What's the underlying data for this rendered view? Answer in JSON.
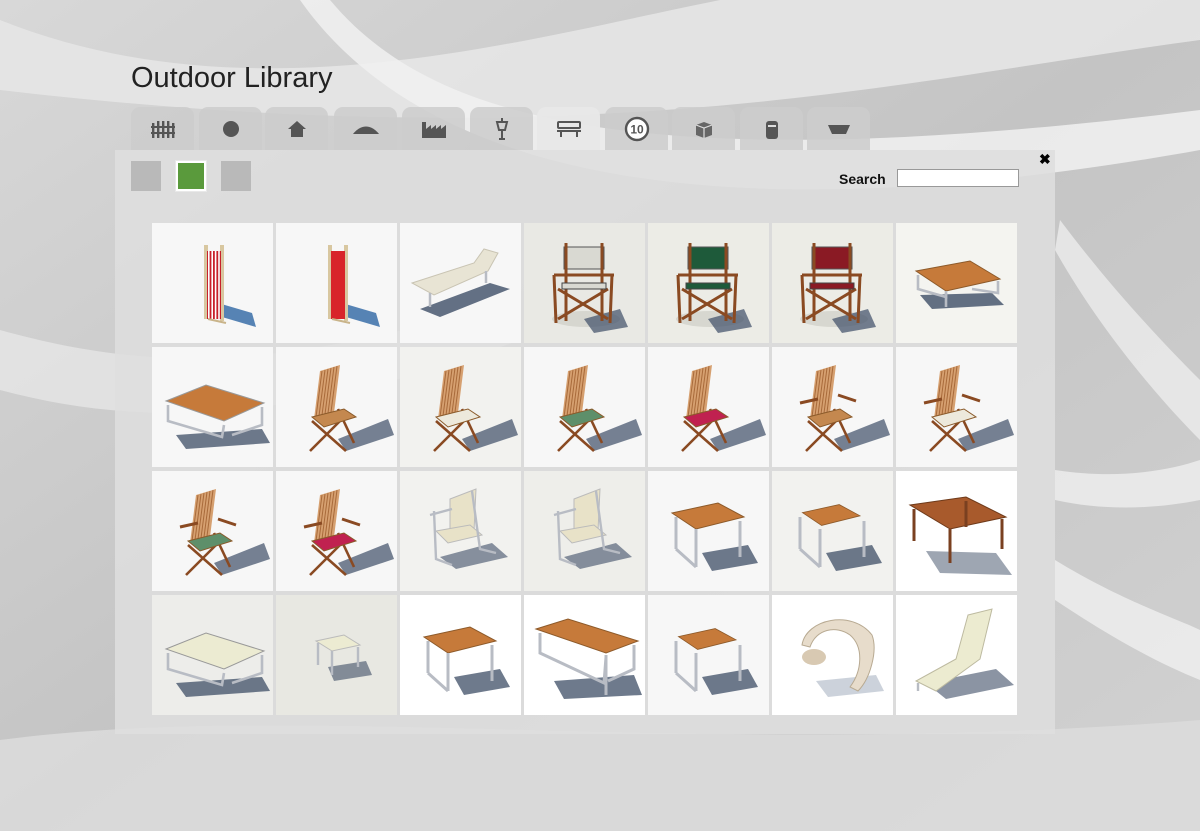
{
  "header": {
    "title": "Outdoor Library"
  },
  "tabs": [
    {
      "icon": "fence-icon",
      "active": false
    },
    {
      "icon": "circle-icon",
      "active": false
    },
    {
      "icon": "house-icon",
      "active": false
    },
    {
      "icon": "mound-icon",
      "active": false
    },
    {
      "icon": "factory-icon",
      "active": false
    },
    {
      "icon": "street-lamp-icon",
      "active": false
    },
    {
      "icon": "bench-icon",
      "active": true
    },
    {
      "icon": "speed-sign-icon",
      "active": false,
      "text": "10"
    },
    {
      "icon": "box-icon",
      "active": false
    },
    {
      "icon": "bin-icon",
      "active": false
    },
    {
      "icon": "planter-icon",
      "active": false
    }
  ],
  "swatches": [
    {
      "color": "#b9b9b9",
      "selected": false
    },
    {
      "color": "#5a9a3c",
      "selected": true
    },
    {
      "color": "#b9b9b9",
      "selected": false
    }
  ],
  "search": {
    "label": "Search",
    "value": "",
    "placeholder": ""
  },
  "close_label": "✖",
  "items": [
    {
      "kind": "deckchair",
      "color": "#c8202a",
      "stripes": true,
      "bg": "#f7f7f7"
    },
    {
      "kind": "deckchair",
      "color": "#d8242a",
      "stripes": false,
      "bg": "#f7f7f7"
    },
    {
      "kind": "lounger",
      "color": "#e8e4d4",
      "bg": "#f7f7f7"
    },
    {
      "kind": "director",
      "color": "#d9d9d2",
      "bg": "#e9e9e4"
    },
    {
      "kind": "director",
      "color": "#1e5a3a",
      "bg": "#ececE6"
    },
    {
      "kind": "director",
      "color": "#8a1a24",
      "bg": "#ececE6"
    },
    {
      "kind": "low-table",
      "color": "#c67a3a",
      "bg": "#f4f4f0"
    },
    {
      "kind": "low-table-wide",
      "color": "#c67a3a",
      "bg": "#f7f7f7"
    },
    {
      "kind": "folding-chair",
      "color": "none",
      "bg": "#f7f7f7"
    },
    {
      "kind": "folding-chair",
      "color": "#ede9dc",
      "bg": "#f2f2ef"
    },
    {
      "kind": "folding-chair",
      "color": "#5e8f6a",
      "bg": "#f7f7f7"
    },
    {
      "kind": "folding-chair",
      "color": "#c02150",
      "bg": "#f7f7f7"
    },
    {
      "kind": "folding-armchair",
      "color": "none",
      "bg": "#f7f7f7"
    },
    {
      "kind": "folding-armchair",
      "color": "#ede9dc",
      "bg": "#f7f7f7"
    },
    {
      "kind": "folding-armchair",
      "color": "#5e8f6a",
      "bg": "#f7f7f7"
    },
    {
      "kind": "folding-armchair",
      "color": "#c02150",
      "bg": "#f7f7f7"
    },
    {
      "kind": "sling-chair",
      "color": "#e8e2c8",
      "bg": "#f2f2ef"
    },
    {
      "kind": "sling-chair",
      "color": "#e8e2c8",
      "bg": "#eeeeea"
    },
    {
      "kind": "side-table",
      "color": "#c67a3a",
      "bg": "#f7f7f7"
    },
    {
      "kind": "side-table-small",
      "color": "#c67a3a",
      "bg": "#f2f2ef"
    },
    {
      "kind": "dining-table",
      "color": "#a85a2c",
      "bg": "#ffffff"
    },
    {
      "kind": "low-table-wide",
      "color": "#ecebd2",
      "bg": "#ededea"
    },
    {
      "kind": "stool",
      "color": "#ecebd2",
      "bg": "#e8e8e2"
    },
    {
      "kind": "side-table",
      "color": "#c67a3a",
      "bg": "#ffffff"
    },
    {
      "kind": "long-table",
      "color": "#c67a3a",
      "bg": "#ffffff"
    },
    {
      "kind": "side-table-small",
      "color": "#c67a3a",
      "bg": "#f7f7f7"
    },
    {
      "kind": "pod-chair",
      "color": "#e7dccb",
      "bg": "#ffffff"
    },
    {
      "kind": "lounge-chair",
      "color": "#ecebd0",
      "bg": "#ffffff"
    }
  ]
}
